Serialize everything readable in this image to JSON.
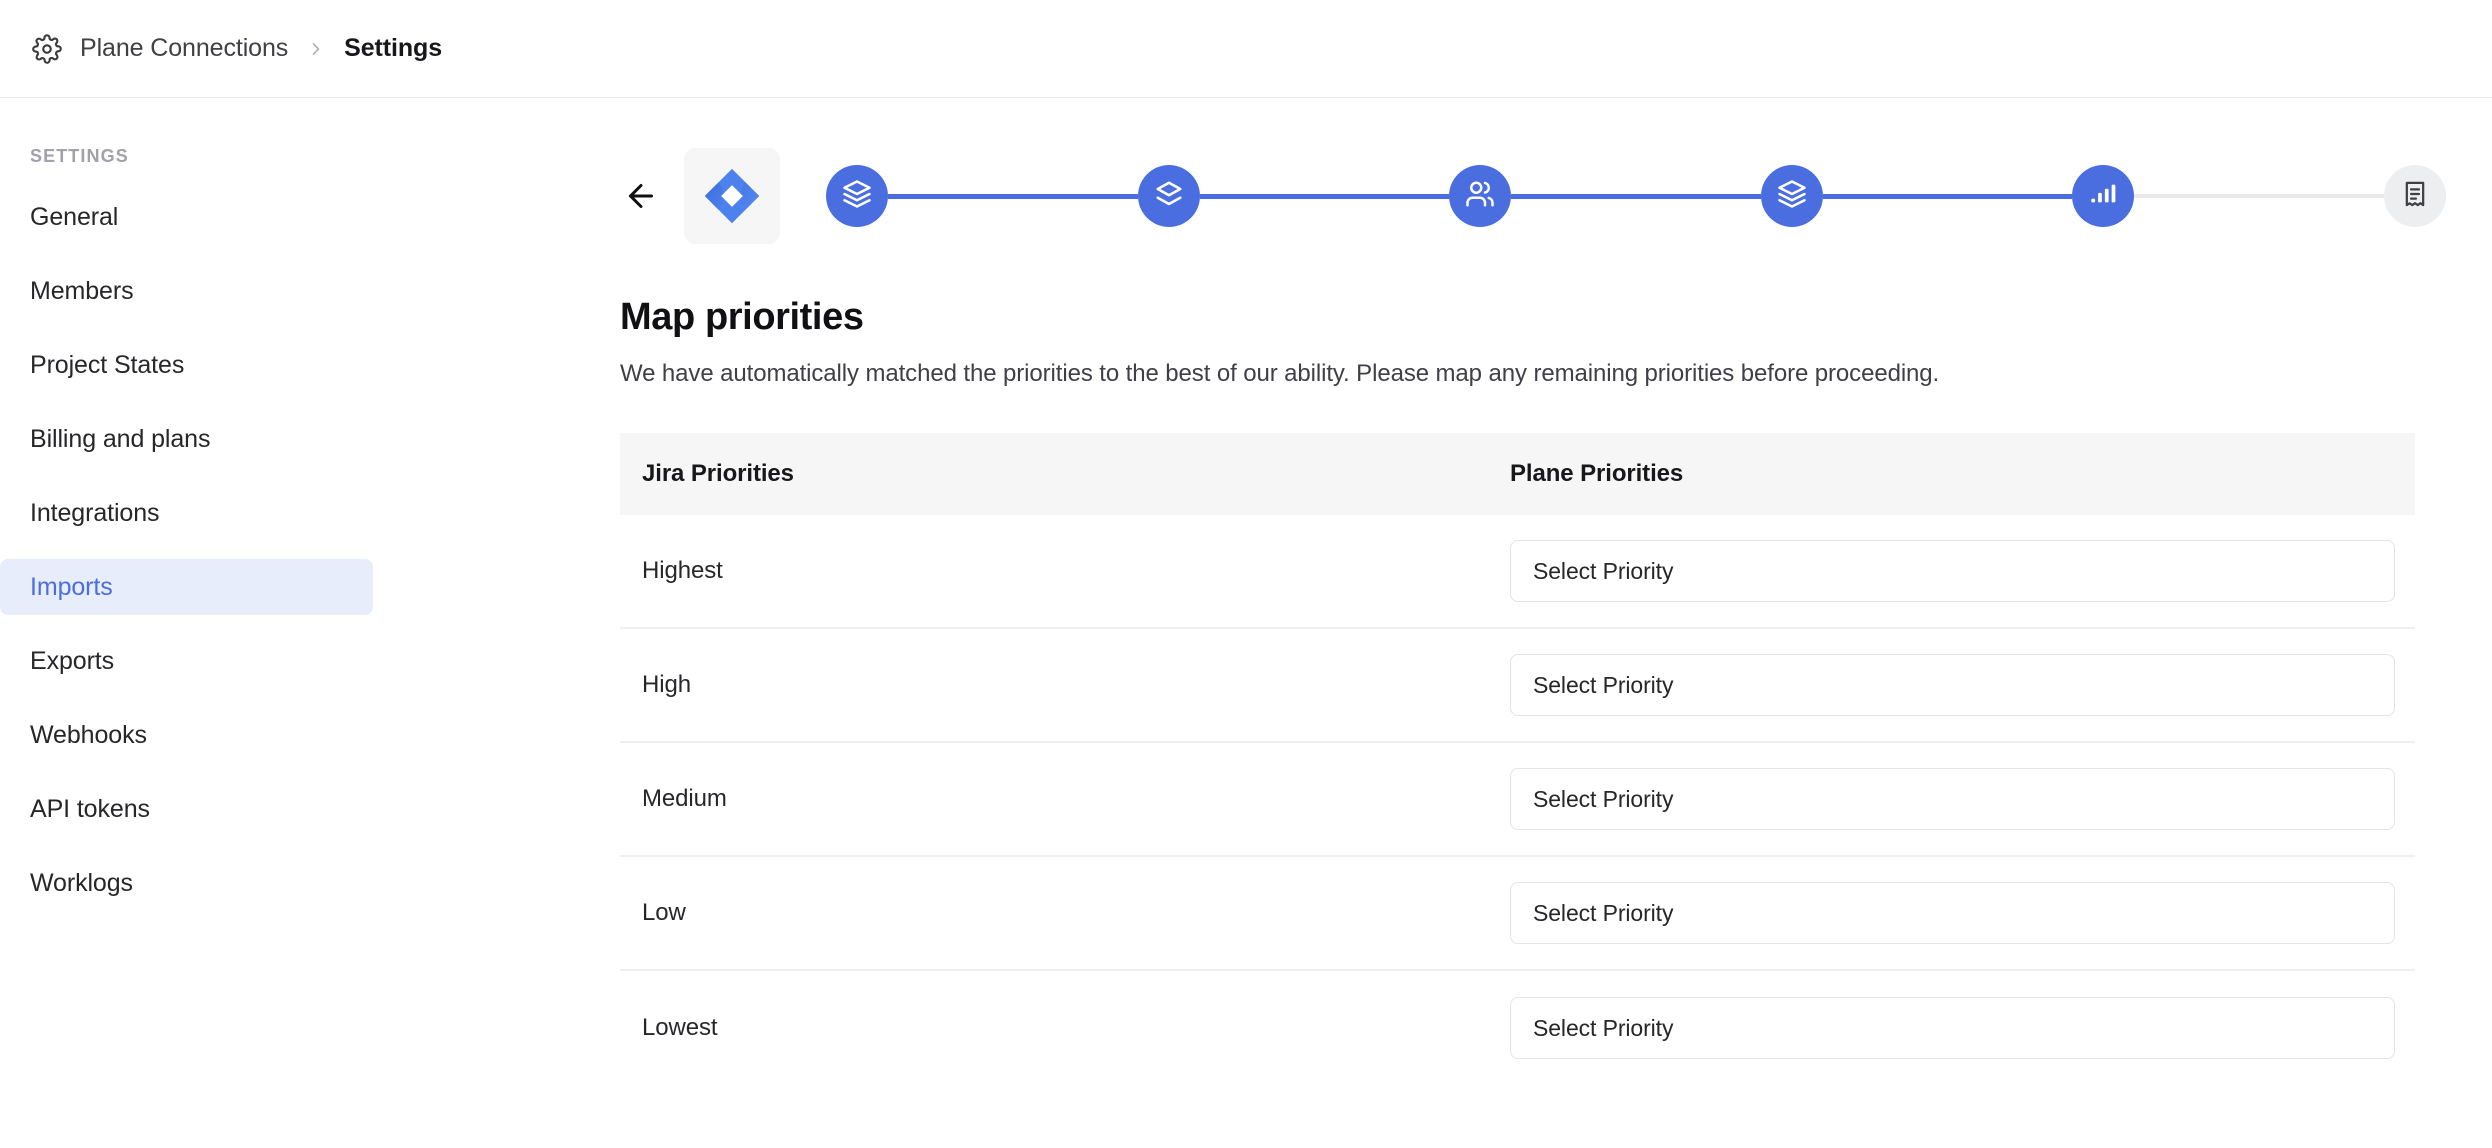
{
  "topbar": {
    "gear_icon": "gear-icon",
    "breadcrumb_root": "Plane Connections",
    "breadcrumb_separator": "›",
    "breadcrumb_current": "Settings"
  },
  "sidebar": {
    "heading": "SETTINGS",
    "items": [
      {
        "label": "General",
        "active": false
      },
      {
        "label": "Members",
        "active": false
      },
      {
        "label": "Project States",
        "active": false
      },
      {
        "label": "Billing and plans",
        "active": false
      },
      {
        "label": "Integrations",
        "active": false
      },
      {
        "label": "Imports",
        "active": true
      },
      {
        "label": "Exports",
        "active": false
      },
      {
        "label": "Webhooks",
        "active": false
      },
      {
        "label": "API tokens",
        "active": false
      },
      {
        "label": "Worklogs",
        "active": false
      }
    ]
  },
  "stepper": {
    "back_icon": "arrow-left-icon",
    "source_logo": "jira-logo-icon",
    "steps": [
      {
        "icon": "layers-three-icon",
        "state": "done"
      },
      {
        "icon": "layers-two-icon",
        "state": "done"
      },
      {
        "icon": "users-icon",
        "state": "done"
      },
      {
        "icon": "layers-three-icon",
        "state": "done"
      },
      {
        "icon": "bar-chart-icon",
        "state": "current"
      },
      {
        "icon": "receipt-icon",
        "state": "pending"
      }
    ]
  },
  "main": {
    "title": "Map priorities",
    "description": "We have automatically matched the priorities to the best of our ability. Please map any remaining priorities before proceeding."
  },
  "table": {
    "columns": [
      "Jira Priorities",
      "Plane Priorities"
    ],
    "rows": [
      {
        "jira": "Highest",
        "plane": "Select Priority"
      },
      {
        "jira": "High",
        "plane": "Select Priority"
      },
      {
        "jira": "Medium",
        "plane": "Select Priority"
      },
      {
        "jira": "Low",
        "plane": "Select Priority"
      },
      {
        "jira": "Lowest",
        "plane": "Select Priority"
      }
    ]
  },
  "colors": {
    "accent": "#4a6ee0",
    "accent_soft": "#e8edfb",
    "header_bg": "#f6f6f7",
    "border": "#e4e4e7",
    "text": "#27272a",
    "muted": "#a1a1aa"
  }
}
